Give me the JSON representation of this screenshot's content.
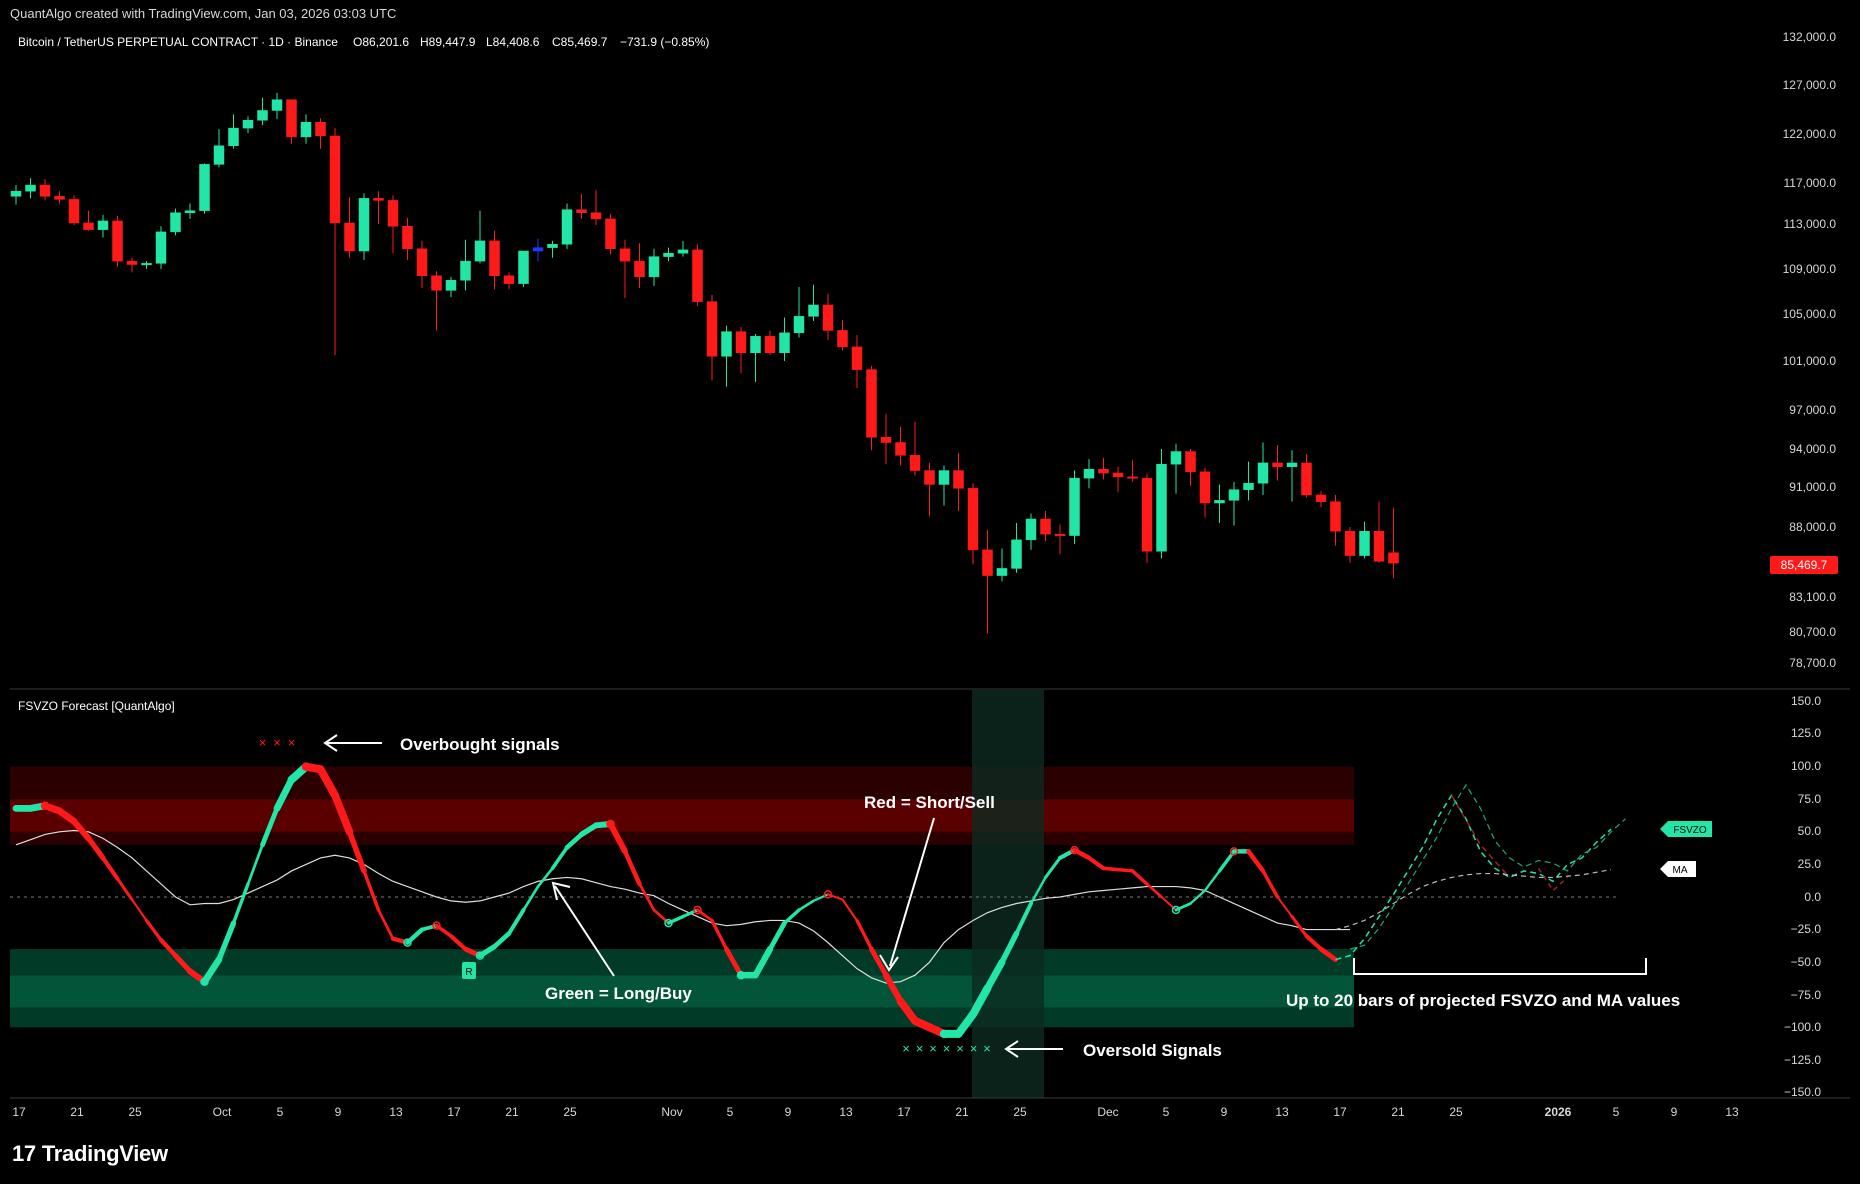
{
  "header": {
    "credit": "QuantAlgo created with TradingView.com, Jan 03, 2026 03:03 UTC"
  },
  "price_pane": {
    "symbol": "Bitcoin / TetherUS PERPETUAL CONTRACT · 1D · Binance",
    "ohlc": {
      "o": "O86,201.6",
      "h": "H89,447.9",
      "l": "L84,408.6",
      "c": "C85,469.7",
      "chg": "−731.9 (−0.85%)"
    },
    "last_price_label": "85,469.7",
    "price_ticks": [
      "132,000.0",
      "127,000.0",
      "122,000.0",
      "117,000.0",
      "113,000.0",
      "109,000.0",
      "105,000.0",
      "101,000.0",
      "97,000.0",
      "94,000.0",
      "91,000.0",
      "88,000.0",
      "83,100.0",
      "80,700.0",
      "78,700.0"
    ]
  },
  "indicator_pane": {
    "title": "FSVZO Forecast [QuantAlgo]",
    "ticks": [
      "150.0",
      "125.0",
      "100.0",
      "75.0",
      "50.0",
      "25.0",
      "0.0",
      "−25.0",
      "−50.0",
      "−75.0",
      "−100.0",
      "−125.0",
      "−150.0"
    ],
    "fsvzo_tag": "FSVZO",
    "ma_tag": "MA",
    "annotations": {
      "overbought": "Overbought signals",
      "oversold": "Oversold Signals",
      "red": "Red = Short/Sell",
      "green": "Green = Long/Buy",
      "projection": "Up to 20 bars of projected FSVZO and MA values"
    },
    "marker_r": "R"
  },
  "time_axis": [
    "17",
    "21",
    "25",
    "Oct",
    "5",
    "9",
    "13",
    "17",
    "21",
    "25",
    "Nov",
    "5",
    "9",
    "13",
    "17",
    "21",
    "25",
    "Dec",
    "5",
    "9",
    "13",
    "17",
    "21",
    "25",
    "2026",
    "5",
    "9",
    "13"
  ],
  "brand": "TradingView",
  "colors": {
    "up": "#22e5a8",
    "down": "#ff1a1a",
    "blue": "#1a3cff",
    "ma": "#dddddd"
  },
  "chart_data": [
    {
      "type": "candlestick",
      "title": "Bitcoin / TetherUS PERPETUAL CONTRACT · 1D · Binance",
      "x_start": "Sep 16, 2025",
      "ylim": [
        78000,
        133000
      ],
      "ohlc": [
        [
          115700,
          116800,
          114900,
          116200
        ],
        [
          116200,
          117500,
          115500,
          116800
        ],
        [
          116800,
          117400,
          115300,
          115700
        ],
        [
          115700,
          116200,
          115000,
          115400
        ],
        [
          115400,
          115800,
          112900,
          113100
        ],
        [
          113100,
          114300,
          112400,
          112500
        ],
        [
          112500,
          113900,
          111800,
          113300
        ],
        [
          113300,
          113800,
          109200,
          109700
        ],
        [
          109700,
          110000,
          108700,
          109400
        ],
        [
          109400,
          109700,
          109000,
          109500
        ],
        [
          109500,
          112800,
          109000,
          112300
        ],
        [
          112300,
          114500,
          112000,
          114100
        ],
        [
          114100,
          115000,
          113500,
          114300
        ],
        [
          114300,
          119000,
          114000,
          118900
        ],
        [
          118900,
          122500,
          118600,
          120800
        ],
        [
          120800,
          124000,
          120500,
          122600
        ],
        [
          122600,
          123800,
          122100,
          123400
        ],
        [
          123400,
          125700,
          122900,
          124400
        ],
        [
          124400,
          126200,
          123500,
          125500
        ],
        [
          125500,
          124800,
          121000,
          121700
        ],
        [
          121700,
          124000,
          121000,
          123200
        ],
        [
          123200,
          123600,
          120500,
          121800
        ],
        [
          121800,
          122600,
          101500,
          113100
        ],
        [
          113100,
          115600,
          110000,
          110600
        ],
        [
          110600,
          116000,
          109800,
          115500
        ],
        [
          115500,
          116200,
          113000,
          115300
        ],
        [
          115300,
          115800,
          110400,
          112800
        ],
        [
          112800,
          113600,
          109800,
          110800
        ],
        [
          110800,
          111500,
          107300,
          108400
        ],
        [
          108400,
          108800,
          103600,
          107100
        ],
        [
          107100,
          108300,
          106500,
          108000
        ],
        [
          108000,
          111600,
          107100,
          109700
        ],
        [
          109700,
          114300,
          109500,
          111500
        ],
        [
          111500,
          112400,
          107200,
          108400
        ],
        [
          108400,
          108700,
          107200,
          107700
        ],
        [
          107700,
          109900,
          107400,
          110600
        ],
        [
          110600,
          111700,
          109700,
          110900
        ],
        [
          110900,
          111500,
          110000,
          111200
        ],
        [
          111200,
          115000,
          110800,
          114400
        ],
        [
          114400,
          115900,
          113500,
          114100
        ],
        [
          114100,
          116300,
          112900,
          113500
        ],
        [
          113500,
          114000,
          110300,
          110800
        ],
        [
          110800,
          111600,
          106400,
          109700
        ],
        [
          109700,
          111300,
          107300,
          108300
        ],
        [
          108300,
          110800,
          107500,
          110100
        ],
        [
          110100,
          110900,
          109700,
          110400
        ],
        [
          110400,
          111500,
          110100,
          110700
        ],
        [
          110700,
          111200,
          105700,
          106100
        ],
        [
          106100,
          106700,
          99400,
          101400
        ],
        [
          101400,
          104000,
          98900,
          103500
        ],
        [
          103500,
          103900,
          100000,
          101700
        ],
        [
          101700,
          103300,
          99300,
          103100
        ],
        [
          103100,
          103600,
          101500,
          101700
        ],
        [
          101700,
          104700,
          101000,
          103400
        ],
        [
          103400,
          107400,
          103000,
          104800
        ],
        [
          104800,
          107600,
          104400,
          105800
        ],
        [
          105800,
          106800,
          102800,
          103600
        ],
        [
          103600,
          104500,
          101900,
          102200
        ],
        [
          102200,
          103200,
          98800,
          100300
        ],
        [
          100300,
          100600,
          93900,
          94900
        ],
        [
          94900,
          96700,
          92800,
          94500
        ],
        [
          94500,
          95700,
          92700,
          93500
        ],
        [
          93500,
          96100,
          91900,
          92300
        ],
        [
          92300,
          92900,
          88800,
          91200
        ],
        [
          91200,
          92700,
          89600,
          92300
        ],
        [
          92300,
          93700,
          89200,
          90900
        ],
        [
          90900,
          91300,
          85400,
          86400
        ],
        [
          86400,
          87800,
          80600,
          84600
        ],
        [
          84600,
          86500,
          84200,
          85100
        ],
        [
          85100,
          88300,
          84800,
          87100
        ],
        [
          87100,
          89000,
          86400,
          88600
        ],
        [
          88600,
          89200,
          87000,
          87500
        ],
        [
          87500,
          88200,
          86100,
          87400
        ],
        [
          87400,
          92300,
          86800,
          91700
        ],
        [
          91700,
          93200,
          90900,
          92400
        ],
        [
          92400,
          93300,
          91600,
          92100
        ],
        [
          92100,
          92600,
          90600,
          91800
        ],
        [
          91800,
          93100,
          91400,
          91700
        ],
        [
          91700,
          92000,
          85500,
          86300
        ],
        [
          86300,
          94000,
          85800,
          92800
        ],
        [
          92800,
          94400,
          90500,
          93800
        ],
        [
          93800,
          94000,
          91100,
          92200
        ],
        [
          92200,
          92500,
          88700,
          89800
        ],
        [
          89800,
          91200,
          88300,
          90000
        ],
        [
          90000,
          91400,
          88100,
          90800
        ],
        [
          90800,
          93000,
          90000,
          91300
        ],
        [
          91300,
          94500,
          90400,
          92900
        ],
        [
          92900,
          94300,
          91500,
          92600
        ],
        [
          92600,
          93900,
          89900,
          92900
        ],
        [
          92900,
          93600,
          90200,
          90400
        ],
        [
          90400,
          90700,
          89500,
          89900
        ],
        [
          89900,
          90400,
          86700,
          87700
        ],
        [
          87700,
          88000,
          85500,
          86000
        ],
        [
          86000,
          88400,
          85800,
          87700
        ],
        [
          87700,
          89900,
          85500,
          85600
        ],
        [
          86201.6,
          89447.9,
          84408.6,
          85469.7
        ]
      ]
    },
    {
      "type": "line",
      "title": "FSVZO Forecast [QuantAlgo]",
      "ylim": [
        -150,
        150
      ],
      "overbought_zone": [
        40,
        100
      ],
      "oversold_zone": [
        -100,
        -40
      ],
      "series": [
        {
          "values": [
            68,
            68,
            70,
            66,
            58,
            45,
            30,
            14,
            -2,
            -18,
            -33,
            -45,
            -57,
            -65,
            -48,
            -20,
            10,
            40,
            68,
            90,
            100,
            98,
            78,
            50,
            20,
            -10,
            -32,
            -35,
            -25,
            -22,
            -30,
            -40,
            -45,
            -38,
            -28,
            -10,
            8,
            22,
            38,
            48,
            55,
            56,
            35,
            10,
            -10,
            -20,
            -15,
            -10,
            -18,
            -40,
            -60,
            -60,
            -40,
            -20,
            -10,
            -3,
            2,
            -2,
            -18,
            -40,
            -60,
            -80,
            -95,
            -100,
            -105,
            -105,
            -90,
            -70,
            -50,
            -28,
            -5,
            15,
            30,
            36,
            30,
            22,
            21,
            20,
            10,
            0,
            -10,
            -5,
            5,
            20,
            35,
            35,
            20,
            0,
            -15,
            -30,
            -40,
            -48
          ]
        },
        {
          "values": [
            40,
            44,
            48,
            50,
            51,
            50,
            45,
            38,
            30,
            20,
            10,
            0,
            -6,
            -5,
            -5,
            -2,
            3,
            8,
            13,
            20,
            25,
            30,
            32,
            30,
            25,
            18,
            12,
            8,
            4,
            0,
            -3,
            -4,
            -3,
            0,
            3,
            8,
            12,
            14,
            15,
            14,
            11,
            8,
            6,
            3,
            1,
            -5,
            -10,
            -15,
            -20,
            -22,
            -21,
            -19,
            -18,
            -18,
            -20,
            -26,
            -35,
            -45,
            -55,
            -62,
            -66,
            -65,
            -60,
            -50,
            -35,
            -25,
            -18,
            -12,
            -8,
            -5,
            -3,
            -1,
            0,
            2,
            4,
            5,
            6,
            7,
            8,
            8,
            8,
            7,
            5,
            0,
            -5,
            -10,
            -15,
            -20,
            -22,
            -25,
            -25,
            -25,
            -25
          ]
        }
      ],
      "projection_fsvzo": [
        -48,
        -45,
        -32,
        -15,
        2,
        20,
        38,
        60,
        78,
        60,
        35,
        22,
        15,
        20,
        18,
        12,
        25,
        30,
        42,
        52
      ],
      "projection_ma": [
        -25,
        -22,
        -18,
        -12,
        -5,
        2,
        8,
        12,
        15,
        17,
        18,
        18,
        17,
        16,
        15,
        15,
        16,
        17,
        19,
        21
      ],
      "overbought_signals": [
        "Oct 3",
        "Oct 4",
        "Oct 5"
      ],
      "oversold_signals": [
        "Nov 16",
        "Nov 17",
        "Nov 18",
        "Nov 19",
        "Nov 20",
        "Nov 21",
        "Nov 22"
      ]
    }
  ]
}
